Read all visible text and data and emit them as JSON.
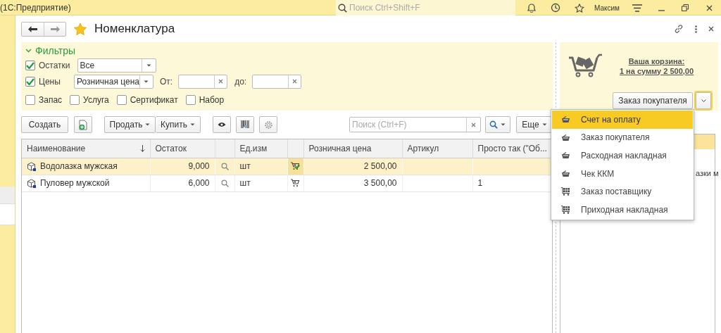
{
  "app": {
    "title": "(1С:Предприятие)",
    "search_placeholder": "Поиск Ctrl+Shift+F",
    "user": "Максим"
  },
  "window": {
    "title": "Номенклатура",
    "favorite": true
  },
  "filters": {
    "title": "Фильтры",
    "expanded": true,
    "stock": {
      "label": "Остатки",
      "checked": true,
      "value": "Все"
    },
    "prices": {
      "label": "Цены",
      "checked": true,
      "value": "Розничная цена",
      "from_label": "От:",
      "to_label": "до:"
    },
    "types": [
      {
        "label": "Запас",
        "checked": false
      },
      {
        "label": "Услуга",
        "checked": false
      },
      {
        "label": "Сертификат",
        "checked": false
      },
      {
        "label": "Набор",
        "checked": false
      }
    ]
  },
  "cart": {
    "title": "Ваша корзина:",
    "summary": "1 на сумму 2 500,00",
    "button": "Заказ покупателя"
  },
  "toolbar": {
    "create": "Создать",
    "sell": "Продать",
    "buy": "Купить",
    "search_placeholder": "Поиск (Ctrl+F)",
    "more": "Еще"
  },
  "table": {
    "columns": [
      {
        "label": "Наименование",
        "sorted": true
      },
      {
        "label": "Остаток",
        "sorted": false
      },
      {
        "sorted": false
      },
      {
        "label": "Ед.изм",
        "sorted": false
      },
      {
        "sorted": false
      },
      {
        "label": "Розничная цена",
        "sorted": false
      },
      {
        "label": "Артикул",
        "sorted": false
      },
      {
        "label": "Просто так (\"Об...",
        "sorted": false
      }
    ],
    "rows": [
      {
        "name": "Водолазка мужская",
        "stock": "9,000",
        "unit": "шт",
        "in_cart": true,
        "price": "2 500,00",
        "selected": true
      },
      {
        "name": "Пуловер мужской",
        "stock": "6,000",
        "unit": "шт",
        "in_cart": false,
        "price": "3 500,00",
        "column_8": "1",
        "selected": false
      }
    ]
  },
  "side_panel": {
    "text": "азки м"
  },
  "menu": {
    "items": [
      {
        "label": "Счет на оплату",
        "kind": "sale",
        "selected": true
      },
      {
        "label": "Заказ покупателя",
        "kind": "sale",
        "selected": false
      },
      {
        "label": "Расходная накладная",
        "kind": "sale",
        "selected": false
      },
      {
        "label": "Чек ККМ",
        "kind": "sale",
        "selected": false
      },
      {
        "label": "Заказ поставщику",
        "kind": "purchase",
        "selected": false
      },
      {
        "label": "Приходная накладная",
        "kind": "purchase",
        "selected": false
      }
    ]
  }
}
